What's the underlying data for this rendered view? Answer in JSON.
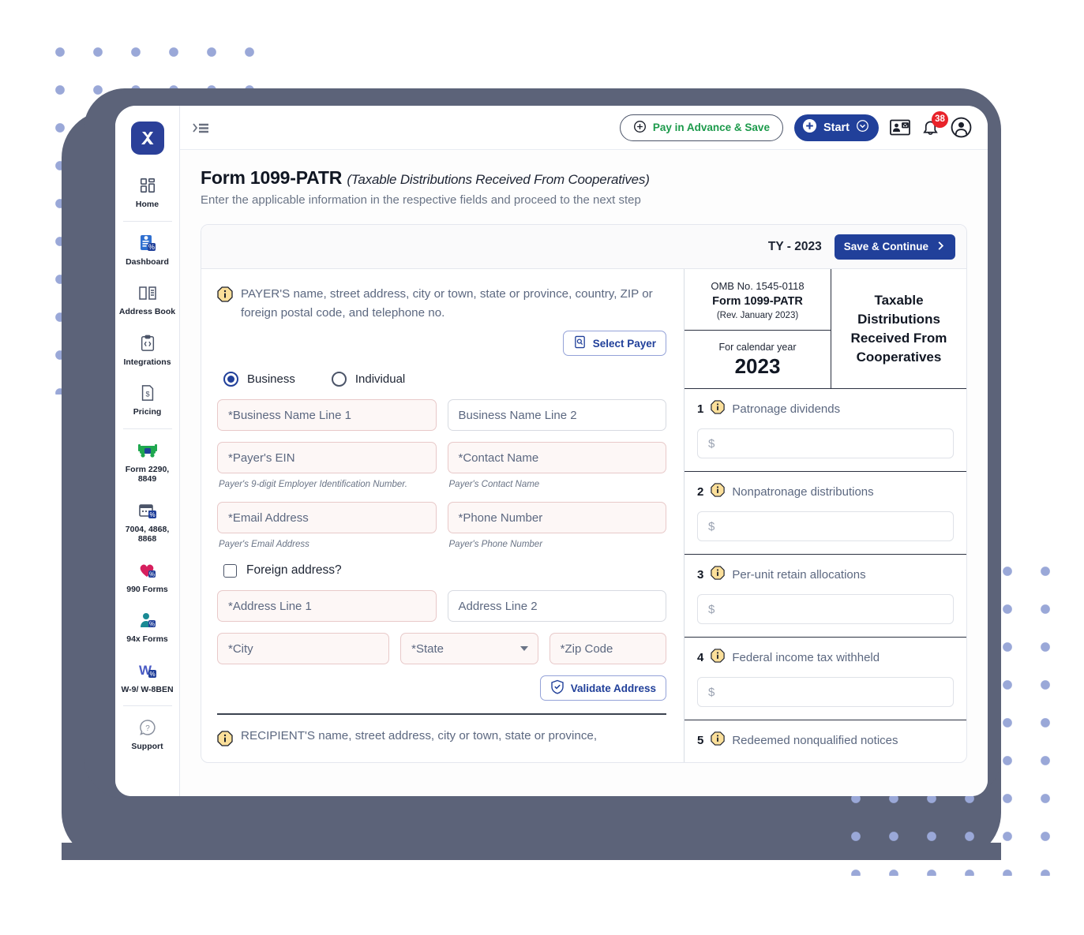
{
  "brand": {
    "logo_text": "X",
    "accent": "#21409a"
  },
  "sidebar": {
    "items": [
      {
        "label": "Home",
        "icon": "grid-icon"
      },
      {
        "label": "Dashboard",
        "icon": "dashboard-icon"
      },
      {
        "label": "Address Book",
        "icon": "address-book-icon"
      },
      {
        "label": "Integrations",
        "icon": "code-icon"
      },
      {
        "label": "Pricing",
        "icon": "price-tag-icon"
      },
      {
        "label": "Form 2290, 8849",
        "icon": "truck-icon"
      },
      {
        "label": "7004, 4868, 8868",
        "icon": "calendar-icon"
      },
      {
        "label": "990 Forms",
        "icon": "heart-icon"
      },
      {
        "label": "94x Forms",
        "icon": "person-icon"
      },
      {
        "label": "W-9/ W-8BEN",
        "icon": "w-form-icon"
      },
      {
        "label": "Support",
        "icon": "question-icon"
      }
    ]
  },
  "topbar": {
    "collapse_icon": "collapse-sidebar-icon",
    "pay_in_advance_label": "Pay in Advance & Save",
    "start_label": "Start",
    "contacts_icon": "contact-card-icon",
    "bell_icon": "bell-icon",
    "notification_count": "38",
    "avatar_icon": "user-avatar-icon"
  },
  "page": {
    "title": "Form 1099-PATR",
    "title_sub": "(Taxable Distributions Received From Cooperatives)",
    "description": "Enter the applicable information in the respective fields and proceed to the next step"
  },
  "card": {
    "tax_year_label": "TY - 2023",
    "save_continue_label": "Save & Continue"
  },
  "payer": {
    "section_text": "PAYER'S name, street address, city or town, state or province, country, ZIP or foreign postal code, and telephone no.",
    "select_payer_label": "Select Payer",
    "entity_type": {
      "business_label": "Business",
      "individual_label": "Individual",
      "selected": "Business"
    },
    "fields": {
      "business_name_1": {
        "placeholder": "*Business Name Line 1",
        "value": "",
        "required": true
      },
      "business_name_2": {
        "placeholder": "Business Name Line 2",
        "value": "",
        "required": false
      },
      "payer_ein": {
        "placeholder": "*Payer's EIN",
        "value": "",
        "required": true,
        "hint": "Payer's 9-digit Employer Identification Number."
      },
      "contact_name": {
        "placeholder": "*Contact Name",
        "value": "",
        "required": true,
        "hint": "Payer's Contact Name"
      },
      "email": {
        "placeholder": "*Email Address",
        "value": "",
        "required": true,
        "hint": "Payer's Email Address"
      },
      "phone": {
        "placeholder": "*Phone Number",
        "value": "",
        "required": true,
        "hint": "Payer's Phone Number"
      },
      "address_1": {
        "placeholder": "*Address Line 1",
        "value": "",
        "required": true
      },
      "address_2": {
        "placeholder": "Address Line 2",
        "value": "",
        "required": false
      },
      "city": {
        "placeholder": "*City",
        "value": "",
        "required": true
      },
      "state": {
        "placeholder": "*State",
        "value": "",
        "required": true
      },
      "zip": {
        "placeholder": "*Zip Code",
        "value": "",
        "required": true
      }
    },
    "foreign_address_label": "Foreign address?",
    "foreign_address_checked": false,
    "validate_address_label": "Validate Address"
  },
  "recipient": {
    "section_text": "RECIPIENT'S name, street address, city or town, state or province,"
  },
  "form_preview": {
    "omb_no": "OMB No. 1545-0118",
    "form_name": "Form 1099-PATR",
    "revision": "(Rev. January 2023)",
    "calendar_year_label": "For calendar year",
    "calendar_year": "2023",
    "form_title": "Taxable Distributions Received From Cooperatives",
    "boxes": [
      {
        "num": "1",
        "label": "Patronage dividends",
        "placeholder": "$",
        "value": ""
      },
      {
        "num": "2",
        "label": "Nonpatronage distributions",
        "placeholder": "$",
        "value": ""
      },
      {
        "num": "3",
        "label": "Per-unit retain allocations",
        "placeholder": "$",
        "value": ""
      },
      {
        "num": "4",
        "label": "Federal income tax withheld",
        "placeholder": "$",
        "value": ""
      },
      {
        "num": "5",
        "label": "Redeemed nonqualified notices",
        "placeholder": "",
        "value": ""
      }
    ]
  }
}
